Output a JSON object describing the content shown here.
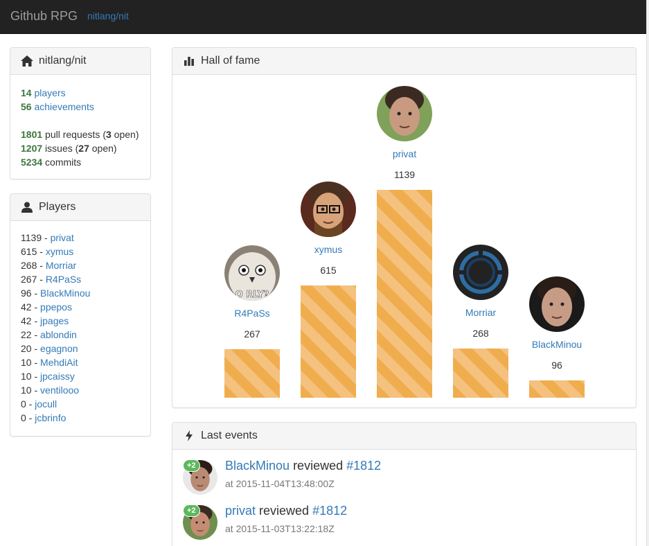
{
  "navbar": {
    "brand": "Github RPG",
    "repo_link": "nitlang/nit"
  },
  "repo_panel": {
    "title": "nitlang/nit",
    "icon": "home-icon",
    "players_count": "14",
    "players_label": "players",
    "achievements_count": "56",
    "achievements_label": "achievements",
    "pull_requests_count": "1801",
    "pull_requests_label": "pull requests (",
    "pull_requests_open": "3",
    "pull_requests_suffix": "open)",
    "issues_count": "1207",
    "issues_label": "issues (",
    "issues_open": "27",
    "issues_suffix": "open)",
    "commits_count": "5234",
    "commits_label": "commits"
  },
  "players_panel": {
    "title": "Players",
    "icon": "user-icon",
    "players": [
      {
        "score": "1139",
        "name": "privat"
      },
      {
        "score": "615",
        "name": "xymus"
      },
      {
        "score": "268",
        "name": "Morriar"
      },
      {
        "score": "267",
        "name": "R4PaSs"
      },
      {
        "score": "96",
        "name": "BlackMinou"
      },
      {
        "score": "42",
        "name": "ppepos"
      },
      {
        "score": "42",
        "name": "jpages"
      },
      {
        "score": "22",
        "name": "ablondin"
      },
      {
        "score": "20",
        "name": "egagnon"
      },
      {
        "score": "10",
        "name": "MehdiAit"
      },
      {
        "score": "10",
        "name": "jpcaissy"
      },
      {
        "score": "10",
        "name": "ventilooo"
      },
      {
        "score": "0",
        "name": "jocull"
      },
      {
        "score": "0",
        "name": "jcbrinfo"
      }
    ]
  },
  "hall_of_fame": {
    "title": "Hall of fame",
    "icon": "bar-chart-icon",
    "entries": [
      {
        "name": "R4PaSs",
        "score": "267",
        "avatar_text": "O RLY?"
      },
      {
        "name": "xymus",
        "score": "615"
      },
      {
        "name": "privat",
        "score": "1139"
      },
      {
        "name": "Morriar",
        "score": "268"
      },
      {
        "name": "BlackMinou",
        "score": "96"
      }
    ]
  },
  "events": {
    "title": "Last events",
    "icon": "lightning-icon",
    "items": [
      {
        "badge": "+2",
        "user": "BlackMinou",
        "action": "reviewed",
        "ref": "#1812",
        "date": "at 2015-11-04T13:48:00Z"
      },
      {
        "badge": "+2",
        "user": "privat",
        "action": "reviewed",
        "ref": "#1812",
        "date": "at 2015-11-03T13:22:18Z"
      }
    ]
  },
  "colors": {
    "navbar": "#222222",
    "link": "#337ab7",
    "green": "#3c763d",
    "bar": "#f0ad4e",
    "badge": "#5cb85c"
  }
}
